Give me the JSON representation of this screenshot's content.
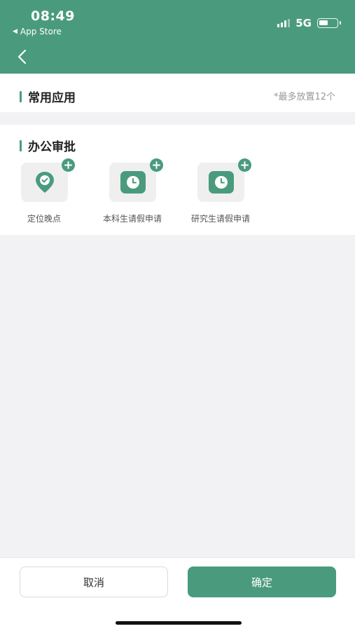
{
  "status_bar": {
    "time": "08:49",
    "back_app": "App Store",
    "network": "5G",
    "battery_level": 0.55
  },
  "nav": {
    "back_icon": "chevron-left-icon"
  },
  "sections": {
    "common": {
      "title": "常用应用",
      "hint": "*最多放置12个"
    },
    "office": {
      "title": "办公审批",
      "apps": [
        {
          "label": "定位晚点",
          "icon": "location-pin-icon"
        },
        {
          "label": "本科生请假申请",
          "icon": "clock-icon"
        },
        {
          "label": "研究生请假申请",
          "icon": "clock-icon"
        }
      ]
    }
  },
  "footer": {
    "cancel_label": "取消",
    "confirm_label": "确定"
  },
  "colors": {
    "accent": "#4a9b7e",
    "background": "#f2f2f4"
  }
}
